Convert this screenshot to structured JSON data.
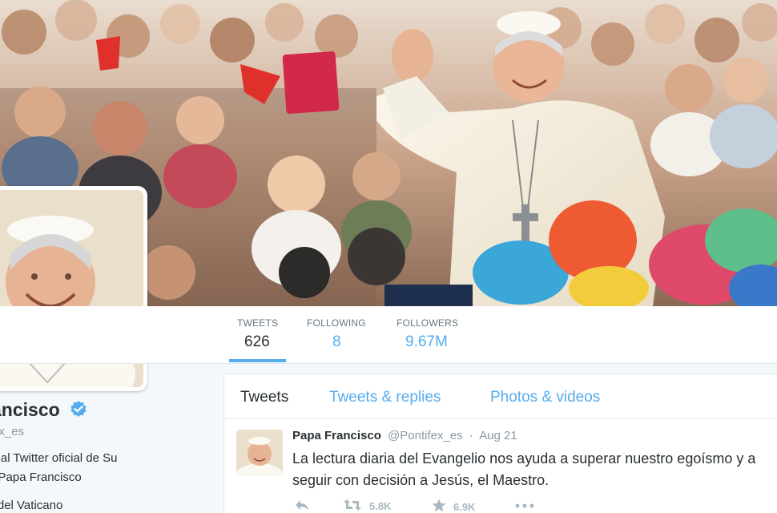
{
  "stats": {
    "tweets": {
      "label": "TWEETS",
      "value": "626"
    },
    "following": {
      "label": "FOLLOWING",
      "value": "8"
    },
    "followers": {
      "label": "FOLLOWERS",
      "value": "9.67M"
    }
  },
  "profile": {
    "name": "Francisco",
    "handle": "ex_es",
    "bio_line1": "do al Twitter oficial de Su",
    "bio_line2": "l Papa Francisco",
    "location": "ad del Vaticano"
  },
  "tabs": {
    "tweets": "Tweets",
    "replies": "Tweets & replies",
    "media": "Photos & videos"
  },
  "tweet": {
    "name": "Papa Francisco",
    "handle": "@Pontifex_es",
    "dot": "·",
    "time": "Aug 21",
    "text": "La lectura diaria del Evangelio nos ayuda a superar nuestro egoísmo y a seguir con decisión a Jesús, el Maestro.",
    "retweets": "5.8K",
    "favorites": "6.9K"
  },
  "colors": {
    "accent": "#55acee",
    "text": "#292f33",
    "muted": "#8899a6",
    "verified": "#55acee"
  },
  "icons": [
    "verified-badge-icon",
    "reply-icon",
    "retweet-icon",
    "favorite-star-icon",
    "more-ellipsis-icon",
    "caret-down-icon"
  ]
}
